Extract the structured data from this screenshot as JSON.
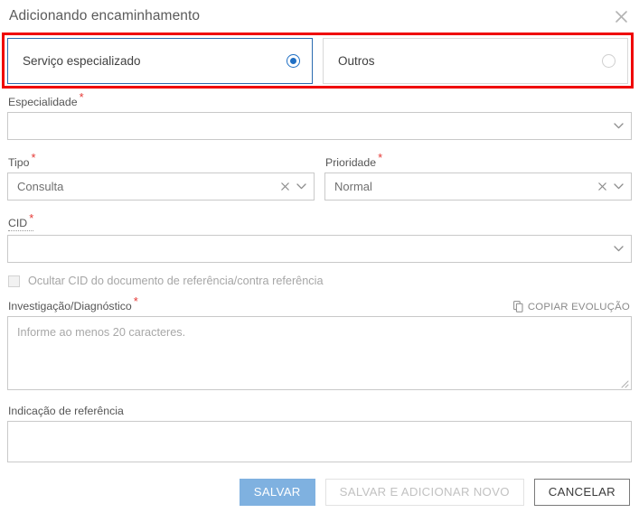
{
  "dialog": {
    "title": "Adicionando encaminhamento",
    "close_icon": "close-icon"
  },
  "referral_type": {
    "options": [
      {
        "label": "Serviço especializado",
        "selected": true
      },
      {
        "label": "Outros",
        "selected": false
      }
    ]
  },
  "fields": {
    "especialidade": {
      "label": "Especialidade",
      "required_marker": "*",
      "value": "",
      "chevron_icon": "chevron-down-icon"
    },
    "tipo": {
      "label": "Tipo",
      "required_marker": "*",
      "value": "Consulta",
      "clear_icon": "clear-x-icon",
      "chevron_icon": "chevron-down-icon"
    },
    "prioridade": {
      "label": "Prioridade",
      "required_marker": "*",
      "value": "Normal",
      "clear_icon": "clear-x-icon",
      "chevron_icon": "chevron-down-icon"
    },
    "cid": {
      "label": "CID",
      "required_marker": "*",
      "value": "",
      "chevron_icon": "chevron-down-icon"
    },
    "ocultar_cid": {
      "label": "Ocultar CID do documento de referência/contra referência",
      "checked": false
    },
    "investigacao": {
      "label": "Investigação/Diagnóstico",
      "required_marker": "*",
      "placeholder": "Informe ao menos 20 caracteres.",
      "value": "",
      "copy_action_label": "COPIAR EVOLUÇÃO",
      "copy_action_icon": "copy-icon"
    },
    "indicacao": {
      "label": "Indicação de referência",
      "value": "",
      "placeholder": ""
    }
  },
  "footer": {
    "save_label": "SALVAR",
    "save_add_new_label": "SALVAR E ADICIONAR NOVO",
    "cancel_label": "CANCELAR"
  },
  "colors": {
    "primary_blue": "#7fb1e0",
    "radio_blue": "#1f6fc4",
    "required_red": "#e53935",
    "highlight_red": "#ef0000",
    "border_gray": "#c9c9c9"
  }
}
